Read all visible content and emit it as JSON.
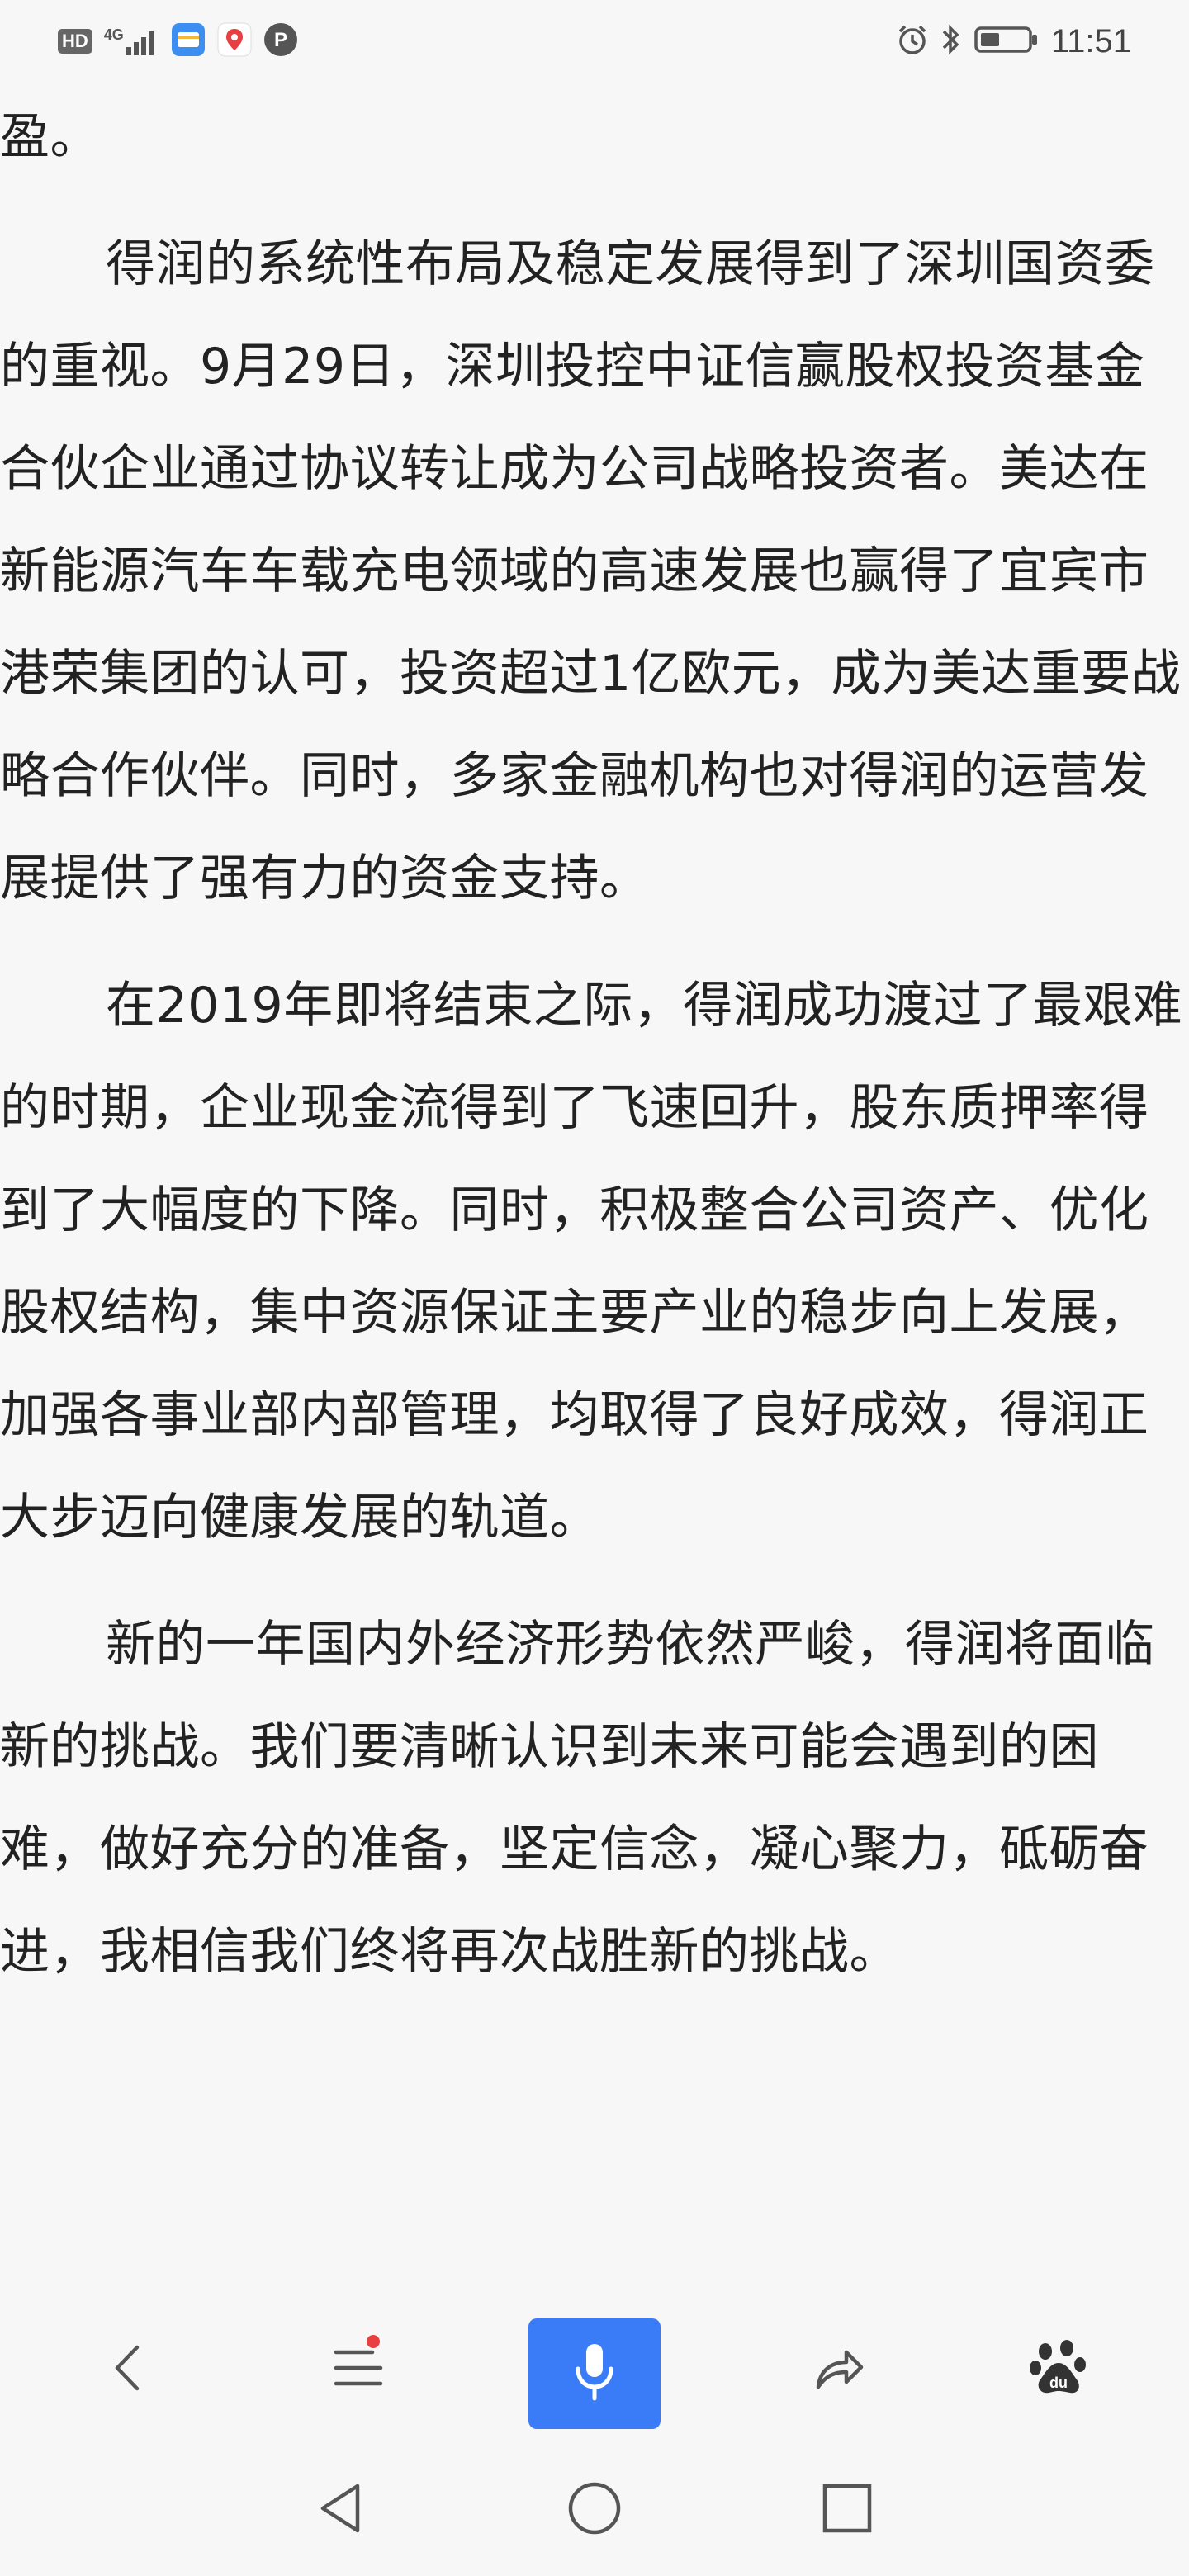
{
  "status_bar": {
    "hd_label": "HD",
    "network_label": "4G",
    "time": "11:51",
    "icons": [
      "signal-icon",
      "wallet-app-icon",
      "maps-app-icon",
      "parking-app-icon",
      "alarm-icon",
      "bluetooth-icon",
      "battery-icon"
    ]
  },
  "article": {
    "paragraphs": [
      "盈。",
      "得润的系统性布局及稳定发展得到了深圳国资委的重视。9月29日，深圳投控中证信赢股权投资基金合伙企业通过协议转让成为公司战略投资者。美达在新能源汽车车载充电领域的高速发展也赢得了宜宾市港荣集团的认可，投资超过1亿欧元，成为美达重要战略合作伙伴。同时，多家金融机构也对得润的运营发展提供了强有力的资金支持。",
      "在2019年即将结束之际，得润成功渡过了最艰难的时期，企业现金流得到了飞速回升，股东质押率得到了大幅度的下降。同时，积极整合公司资产、优化股权结构，集中资源保证主要产业的稳步向上发展，加强各事业部内部管理，均取得了良好成效，得润正大步迈向健康发展的轨道。",
      "新的一年国内外经济形势依然严峻，得润将面临新的挑战。我们要清晰认识到未来可能会遇到的困难，做好充分的准备，坚定信念，凝心聚力，砥砺奋进，我相信我们终将再次战胜新的挑战。"
    ]
  },
  "toolbar": {
    "icons": [
      "back-icon",
      "menu-icon",
      "microphone-icon",
      "share-icon",
      "baidu-paw-icon"
    ],
    "accent_color": "#3a7bf7",
    "notification_color": "#e84040"
  },
  "navigation_bar": {
    "icons": [
      "nav-back-icon",
      "nav-home-icon",
      "nav-recents-icon"
    ]
  }
}
